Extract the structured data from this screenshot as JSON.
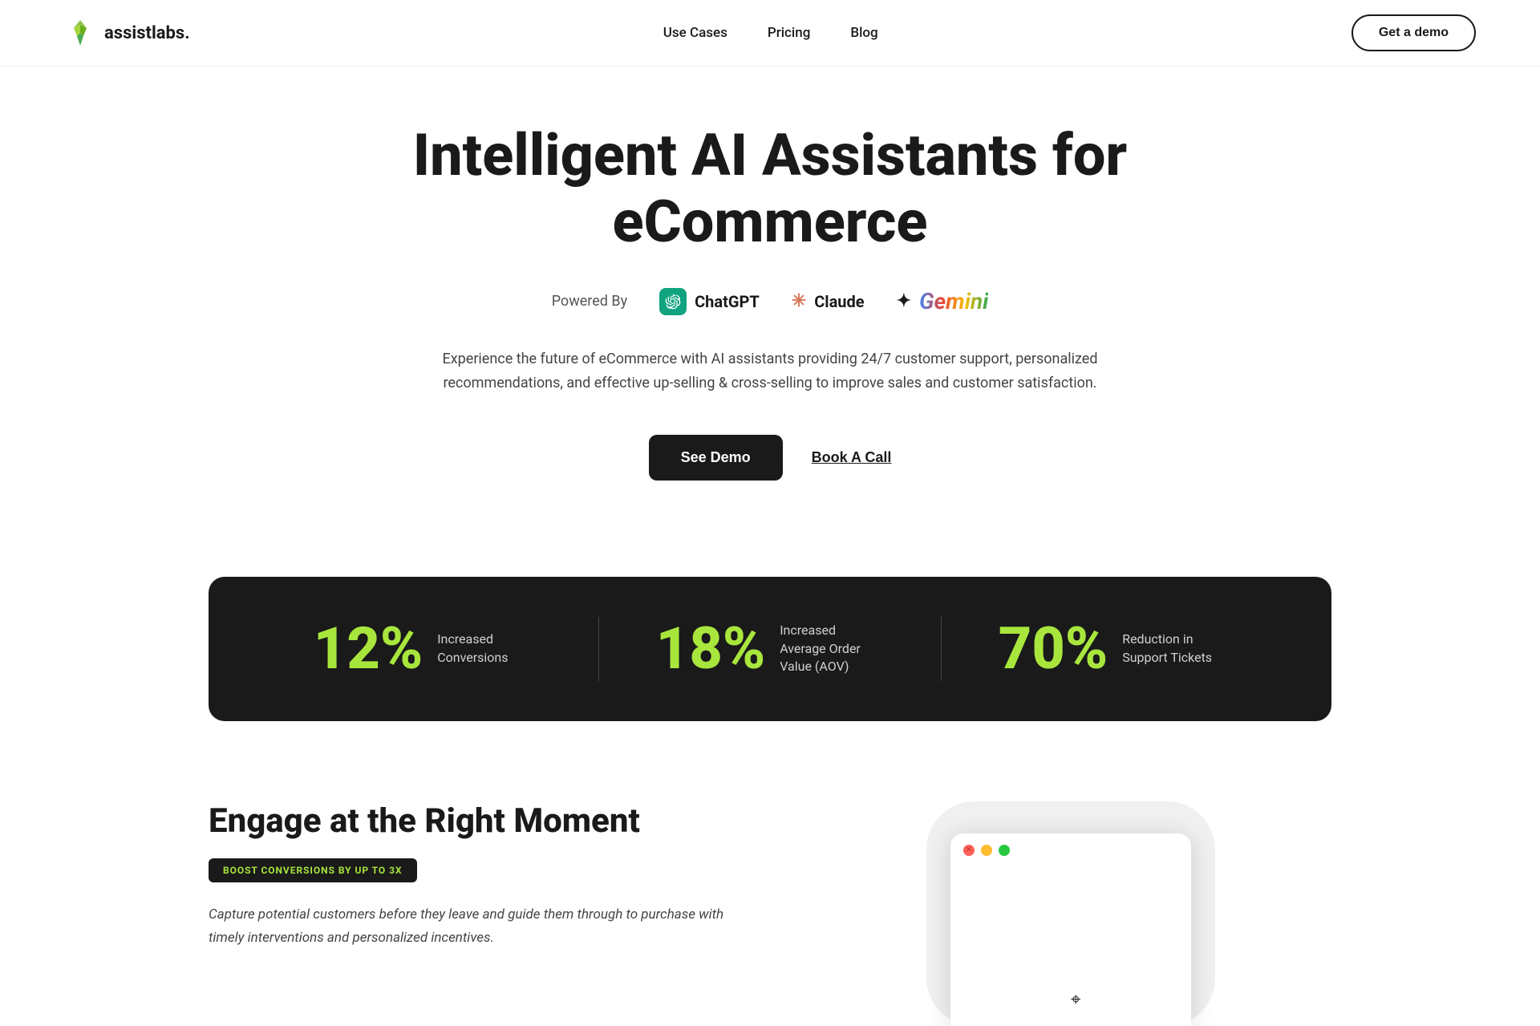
{
  "nav": {
    "logo_text": "assistlabs.",
    "links": [
      {
        "label": "Use Cases",
        "id": "use-cases"
      },
      {
        "label": "Pricing",
        "id": "pricing"
      },
      {
        "label": "Blog",
        "id": "blog"
      }
    ],
    "cta_label": "Get a demo"
  },
  "hero": {
    "title_line1": "Intelligent AI Assistants for",
    "title_line2": "eCommerce",
    "powered_by_label": "Powered By",
    "ai_brands": [
      {
        "name": "ChatGPT",
        "type": "chatgpt"
      },
      {
        "name": "Claude",
        "type": "claude"
      },
      {
        "name": "Gemini",
        "type": "gemini"
      }
    ],
    "description": "Experience the future of eCommerce with AI assistants providing 24/7 customer support, personalized recommendations, and effective up-selling & cross-selling to improve sales and customer satisfaction.",
    "cta_primary": "See Demo",
    "cta_secondary": "Book A Call"
  },
  "stats": [
    {
      "number": "12%",
      "label": "Increased Conversions"
    },
    {
      "number": "18%",
      "label": "Increased Average Order Value (AOV)"
    },
    {
      "number": "70%",
      "label": "Reduction in Support Tickets"
    }
  ],
  "engage": {
    "title": "Engage at the Right Moment",
    "badge": "BOOST CONVERSIONS BY UP TO 3X",
    "description": "Capture potential customers before they leave and guide them through to purchase with timely interventions and personalized incentives."
  },
  "browser": {
    "dots": [
      "red",
      "yellow",
      "green"
    ]
  }
}
